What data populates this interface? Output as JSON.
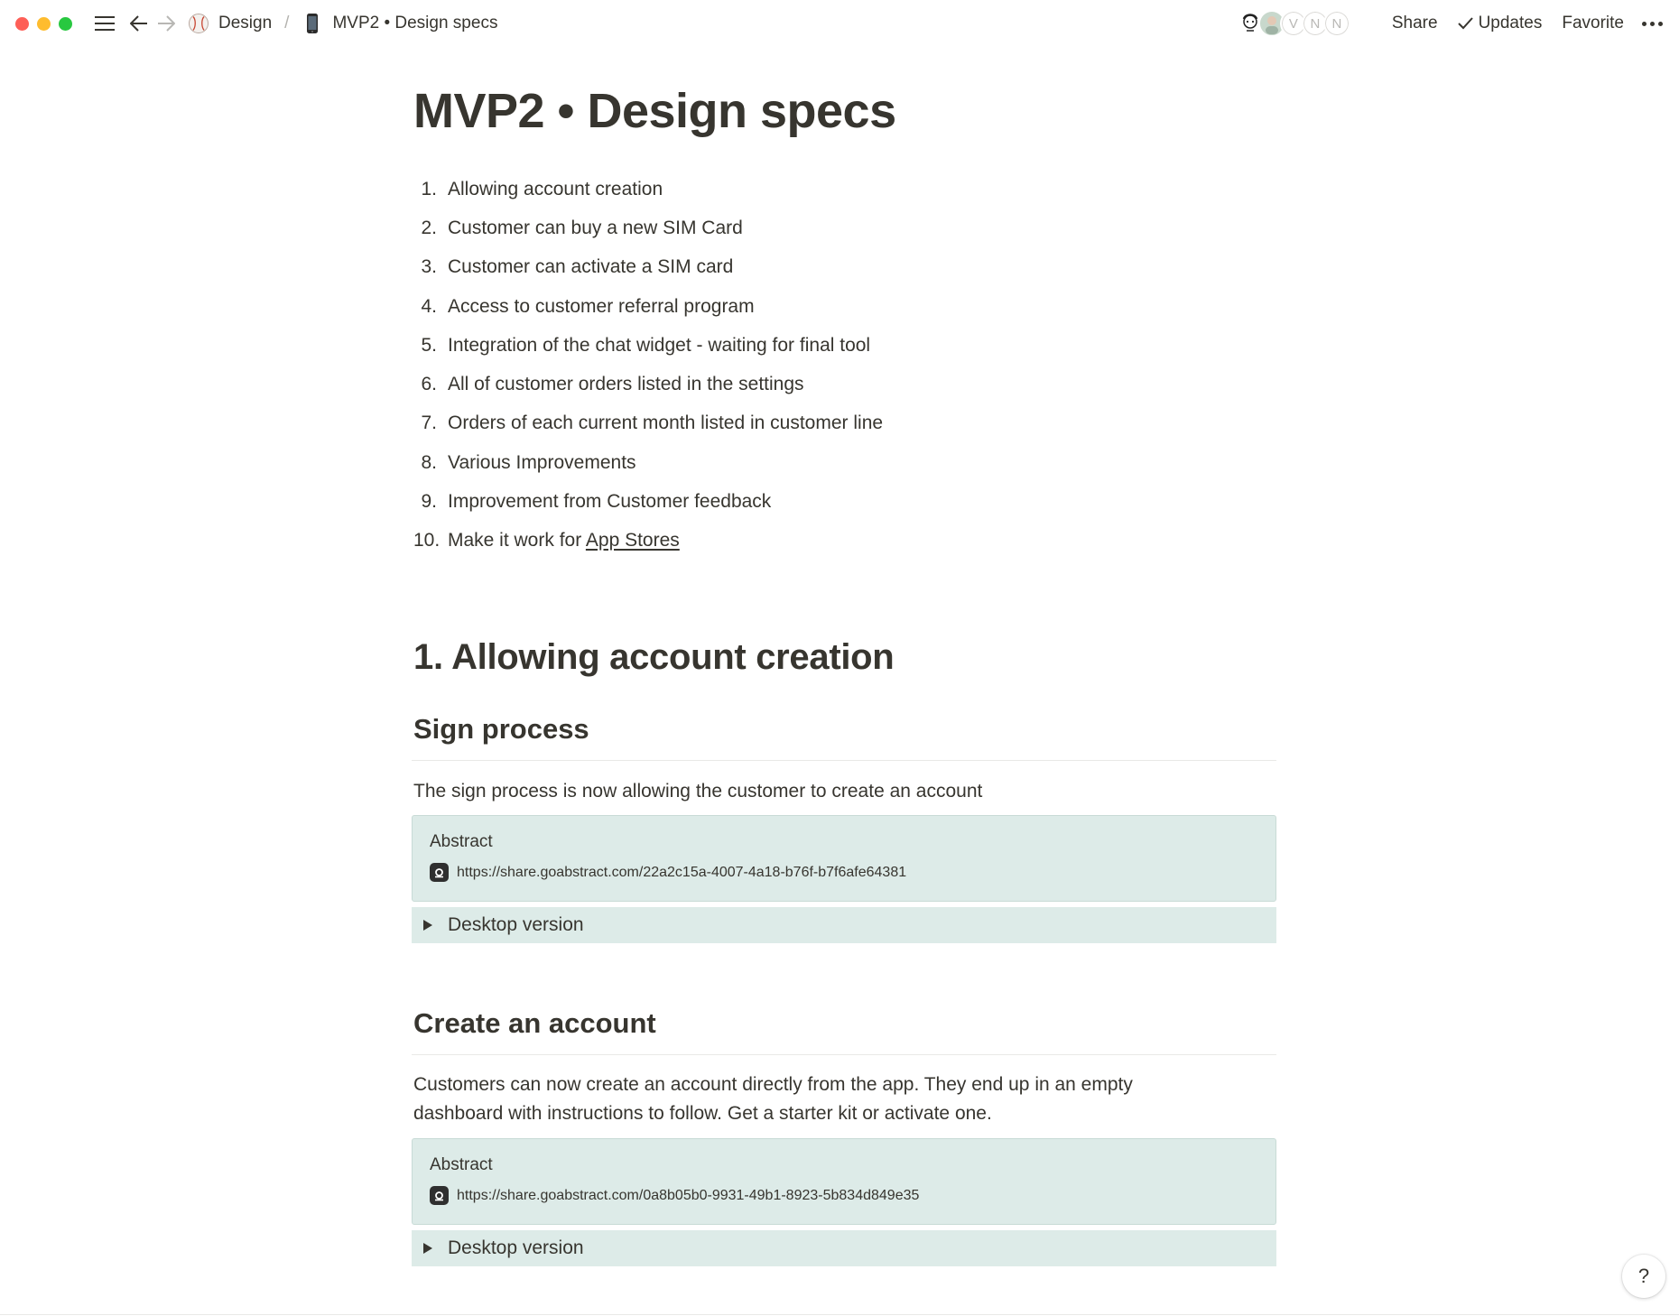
{
  "window": {
    "traffic_lights": [
      "close",
      "minimize",
      "zoom"
    ],
    "colors": {
      "close": "#fe5f57",
      "minimize": "#febc2e",
      "zoom": "#28c840"
    }
  },
  "topbar": {
    "breadcrumbs": [
      {
        "icon": "baseball-icon",
        "label": "Design"
      },
      {
        "icon": "phone-icon",
        "label": "MVP2 • Design specs"
      }
    ],
    "separator": "/",
    "avatars": [
      {
        "kind": "face-illustration",
        "initial": ""
      },
      {
        "kind": "photo",
        "initial": ""
      },
      {
        "kind": "initial",
        "initial": "V"
      },
      {
        "kind": "initial",
        "initial": "N"
      },
      {
        "kind": "initial",
        "initial": "N"
      }
    ],
    "share_label": "Share",
    "updates_label": "Updates",
    "favorite_label": "Favorite"
  },
  "page": {
    "title": "MVP2 • Design specs",
    "list": [
      {
        "num": "1.",
        "text": "Allowing account creation"
      },
      {
        "num": "2.",
        "text": "Customer can buy a new SIM Card"
      },
      {
        "num": "3.",
        "text": "Customer can activate a SIM card"
      },
      {
        "num": "4.",
        "text": "Access to customer referral program"
      },
      {
        "num": "5.",
        "text": "Integration of the chat widget - waiting for final tool"
      },
      {
        "num": "6.",
        "text": "All of customer orders listed in the settings"
      },
      {
        "num": "7.",
        "text": "Orders of each current month listed in customer line"
      },
      {
        "num": "8.",
        "text": "Various Improvements"
      },
      {
        "num": "9.",
        "text": "Improvement from Customer feedback"
      },
      {
        "num": "10.",
        "text_prefix": "Make it work for ",
        "link": "App Stores"
      }
    ],
    "section1": {
      "heading": "1. Allowing account creation",
      "sign_process": {
        "heading": "Sign process",
        "paragraph": "The sign process is now allowing the customer to create an account",
        "embed_title": "Abstract",
        "embed_url": "https://share.goabstract.com/22a2c15a-4007-4a18-b76f-b7f6afe64381",
        "toggle_label": "Desktop version"
      },
      "create_account": {
        "heading": "Create an account",
        "paragraph_line1": "Customers can now create an account directly from the app. They end up in an empty",
        "paragraph_line2": "dashboard with instructions to follow. Get a starter kit or activate one.",
        "embed_title": "Abstract",
        "embed_url": "https://share.goabstract.com/0a8b05b0-9931-49b1-8923-5b834d849e35",
        "toggle_label": "Desktop version"
      }
    },
    "accent_block_color": "#ddebe8"
  },
  "help": {
    "label": "?"
  }
}
